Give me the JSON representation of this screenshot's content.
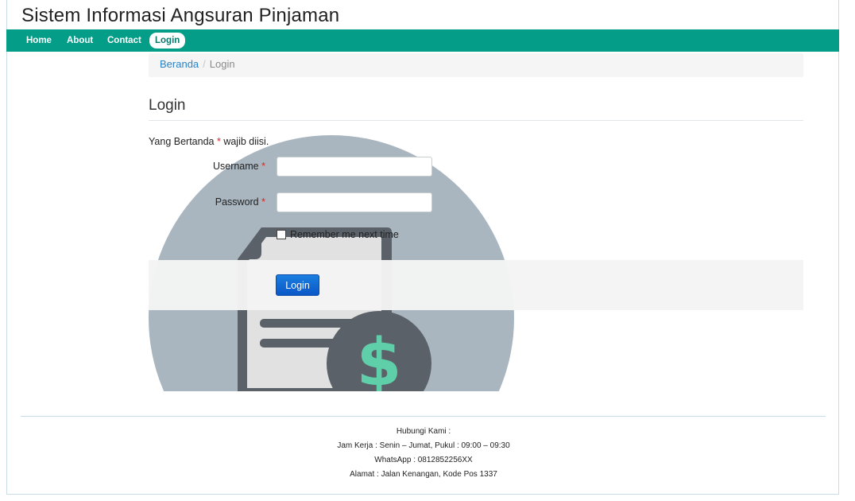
{
  "header": {
    "title": "Sistem Informasi Angsuran Pinjaman"
  },
  "nav": {
    "items": [
      {
        "label": "Home",
        "active": false
      },
      {
        "label": "About",
        "active": false
      },
      {
        "label": "Contact",
        "active": false
      },
      {
        "label": "Login",
        "active": true
      }
    ]
  },
  "breadcrumb": {
    "home": "Beranda",
    "separator": "/",
    "current": "Login"
  },
  "login": {
    "title": "Login",
    "note_prefix": "Yang Bertanda",
    "note_suffix": "wajib diisi.",
    "required_marker": "*",
    "username_label": "Username",
    "password_label": "Password",
    "username_value": "",
    "password_value": "",
    "remember_label": "Remember me next time",
    "remember_checked": false,
    "submit_label": "Login"
  },
  "footer": {
    "heading": "Hubungi Kami :",
    "hours": "Jam Kerja : Senin – Jumat, Pukul : 09:00 – 09:30",
    "whatsapp": "WhatsApp : 0812852256XX",
    "address": "Alamat : Jalan Kenangan, Kode Pos 1337"
  },
  "colors": {
    "navbar": "#049d88",
    "link": "#2a83c4",
    "button": "#0b57c7",
    "illustration_circle": "#a9b6c0",
    "illustration_dark": "#5b6169",
    "dollar": "#5ecfa9"
  },
  "icons": {
    "illustration": "invoice-dollar-illustration"
  }
}
